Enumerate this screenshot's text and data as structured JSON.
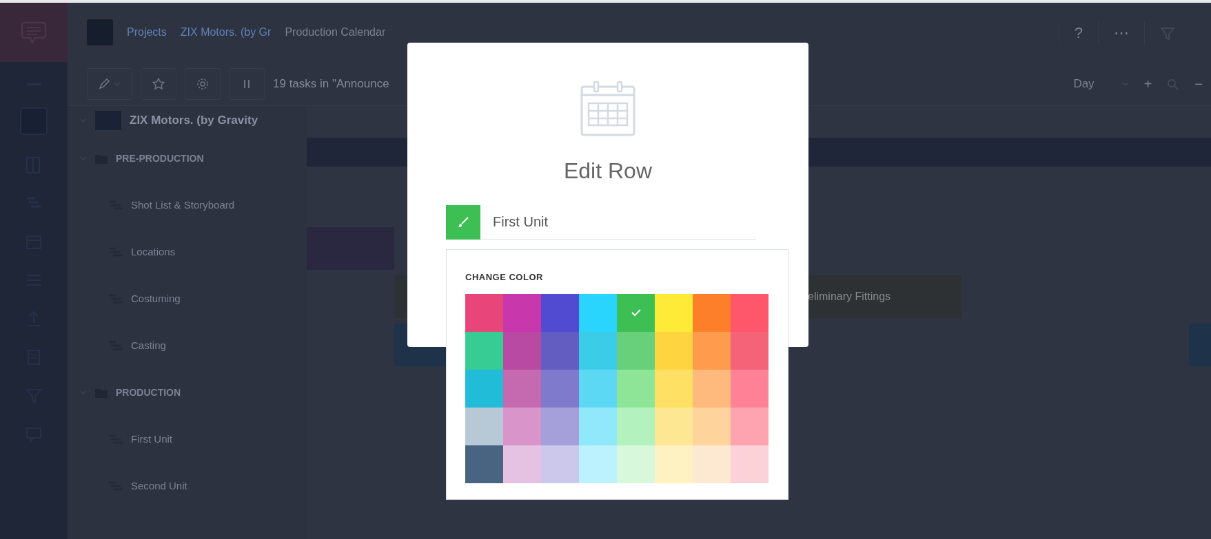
{
  "header": {
    "breadcrumbs": [
      {
        "label": "Projects"
      },
      {
        "label": "ZIX Motors. (by Gr"
      },
      {
        "label": "Production Calendar"
      }
    ],
    "help": "?",
    "more": "⋯"
  },
  "toolbar": {
    "task_summary": "19 tasks in \"Announce",
    "zoom_level": "Day",
    "add": "+",
    "remove": "−"
  },
  "tree": [
    {
      "label": "ZIX Motors. (by Gravity",
      "kind": "project",
      "children": [
        {
          "label": "PRE-PRODUCTION",
          "kind": "folder",
          "children": [
            {
              "label": "Shot List & Storyboard",
              "kind": "row"
            },
            {
              "label": "Locations",
              "kind": "row"
            },
            {
              "label": "Costuming",
              "kind": "row"
            },
            {
              "label": "Casting",
              "kind": "row"
            }
          ]
        },
        {
          "label": "PRODUCTION",
          "kind": "folder",
          "children": [
            {
              "label": "First Unit",
              "kind": "row"
            },
            {
              "label": "Second Unit",
              "kind": "row"
            }
          ]
        }
      ]
    }
  ],
  "gantt_bars": [
    {
      "color": "#20263a"
    },
    {
      "color": "#2a2840"
    },
    {
      "color": "#2e3133",
      "text": "eliminary Fittings"
    },
    {
      "color": "#1e3349"
    },
    {
      "color": "#1e3349"
    }
  ],
  "modal": {
    "title": "Edit Row",
    "row_name": "First Unit",
    "color_picker": {
      "title": "CHANGE COLOR",
      "swatches": [
        {
          "color": "#e8457a",
          "selected": false
        },
        {
          "color": "#c837ab",
          "selected": false
        },
        {
          "color": "#514bd1",
          "selected": false
        },
        {
          "color": "#29d5fc",
          "selected": false
        },
        {
          "color": "#3ebf54",
          "selected": true
        },
        {
          "color": "#fdeb37",
          "selected": false
        },
        {
          "color": "#fe7f2a",
          "selected": false
        },
        {
          "color": "#fe566b",
          "selected": false
        },
        {
          "color": "#38cc95",
          "selected": false
        },
        {
          "color": "#b84aa3",
          "selected": false
        },
        {
          "color": "#635dc1",
          "selected": false
        },
        {
          "color": "#3bcce8",
          "selected": false
        },
        {
          "color": "#68d07b",
          "selected": false
        },
        {
          "color": "#fed540",
          "selected": false
        },
        {
          "color": "#fe9b4d",
          "selected": false
        },
        {
          "color": "#f46378",
          "selected": false
        },
        {
          "color": "#20bcd8",
          "selected": false
        },
        {
          "color": "#c56ab1",
          "selected": false
        },
        {
          "color": "#7f7acc",
          "selected": false
        },
        {
          "color": "#5cd8f4",
          "selected": false
        },
        {
          "color": "#8ee597",
          "selected": false
        },
        {
          "color": "#fee065",
          "selected": false
        },
        {
          "color": "#feba7c",
          "selected": false
        },
        {
          "color": "#fe8195",
          "selected": false
        },
        {
          "color": "#b7c8d6",
          "selected": false
        },
        {
          "color": "#d994ca",
          "selected": false
        },
        {
          "color": "#a6a0da",
          "selected": false
        },
        {
          "color": "#90e8fb",
          "selected": false
        },
        {
          "color": "#b3f2bf",
          "selected": false
        },
        {
          "color": "#fee793",
          "selected": false
        },
        {
          "color": "#fed39c",
          "selected": false
        },
        {
          "color": "#fea4b0",
          "selected": false
        },
        {
          "color": "#486480",
          "selected": false
        },
        {
          "color": "#e6c2e2",
          "selected": false
        },
        {
          "color": "#cbc8ec",
          "selected": false
        },
        {
          "color": "#bbf2fd",
          "selected": false
        },
        {
          "color": "#d8f8dc",
          "selected": false
        },
        {
          "color": "#fef2c3",
          "selected": false
        },
        {
          "color": "#fde9d2",
          "selected": false
        },
        {
          "color": "#fdd1d8",
          "selected": false
        }
      ]
    }
  }
}
